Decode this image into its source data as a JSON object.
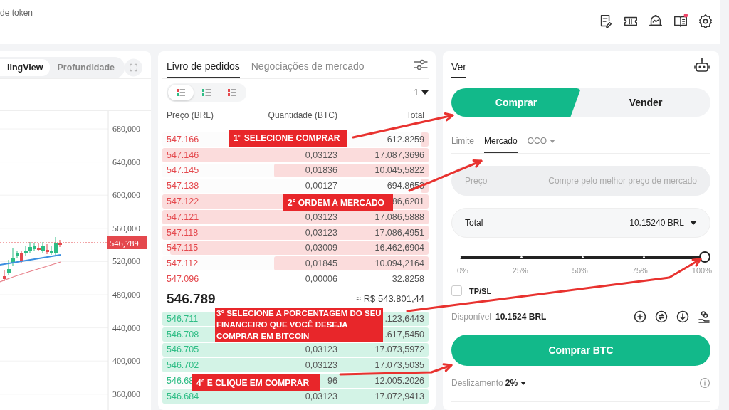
{
  "top_bar": {
    "title": "de token",
    "icons": [
      {
        "kind": "notes",
        "badge": false
      },
      {
        "kind": "ticket",
        "badge": false
      },
      {
        "kind": "bell",
        "badge": false
      },
      {
        "kind": "book",
        "badge": true
      },
      {
        "kind": "settings",
        "badge": false
      }
    ]
  },
  "chart": {
    "tabs": [
      {
        "label": "lingView",
        "selected": true
      },
      {
        "label": "Profundidade",
        "selected": false
      }
    ],
    "y_labels": [
      "680,000",
      "640,000",
      "600,000",
      "560,000",
      "520,000",
      "480,000",
      "440,000",
      "400,000",
      "360,000"
    ],
    "price_tag": "546,789"
  },
  "order_book": {
    "tabs": [
      {
        "label": "Livro de pedidos",
        "selected": true
      },
      {
        "label": "Negociações de mercado",
        "selected": false
      }
    ],
    "views": [
      {
        "kind": "both",
        "selected": true
      },
      {
        "kind": "bids",
        "selected": false
      },
      {
        "kind": "asks",
        "selected": false
      }
    ],
    "precision": "1",
    "columns": [
      "Preço (BRL)",
      "Quantidade (BTC)",
      "Total"
    ],
    "asks": [
      {
        "price": "547.166",
        "total": "612.8259",
        "level": 0.03
      },
      {
        "price": "547.146",
        "quantity": "0,03123",
        "total": "17.087,3696",
        "level": 1
      },
      {
        "price": "547.145",
        "quantity": "0,01836",
        "total": "10.045,5822",
        "level": 0.58
      },
      {
        "price": "547.138",
        "quantity": "0,00127",
        "total": "694.8653",
        "level": 0.03
      },
      {
        "price": "547.122",
        "total": "86,6201",
        "level": 1
      },
      {
        "price": "547.121",
        "quantity": "0,03123",
        "total": "17.086,5888",
        "level": 1
      },
      {
        "price": "547.118",
        "quantity": "0,03123",
        "total": "17.086,4951",
        "level": 1
      },
      {
        "price": "547.115",
        "quantity": "0,03009",
        "total": "16.462,6904",
        "level": 0.97
      },
      {
        "price": "547.112",
        "quantity": "0,01845",
        "total": "10.094,2164",
        "level": 0.58
      },
      {
        "price": "547.096",
        "quantity": "0,00006",
        "total": "32.8258"
      }
    ],
    "last_price": "546.789",
    "last_price_fiat": "≈ R$ 543.801,44",
    "bids": [
      {
        "price": "546.711",
        "total": ".123,6443",
        "level": 1
      },
      {
        "price": "546.708",
        "total": ".617,5450",
        "level": 1
      },
      {
        "price": "546.705",
        "quantity": "0,03123",
        "total": "17.073,5972",
        "level": 1
      },
      {
        "price": "546.702",
        "quantity": "0,03123",
        "total": "17.073,5035",
        "level": 1
      },
      {
        "price": "546.68",
        "quantity": "96",
        "total": "12.005.2026",
        "level": 0.7
      },
      {
        "price": "546.684",
        "quantity": "0,03123",
        "total": "17.072,9413",
        "level": 1
      }
    ]
  },
  "trade": {
    "tab": "Ver",
    "sides": [
      {
        "label": "Comprar",
        "selected": true
      },
      {
        "label": "Vender",
        "selected": false
      }
    ],
    "order_types": [
      {
        "label": "Limite",
        "selected": false,
        "dropdown": false
      },
      {
        "label": "Mercado",
        "selected": true,
        "dropdown": false
      },
      {
        "label": "OCO",
        "selected": false,
        "dropdown": true
      }
    ],
    "price_field": {
      "label": "Preço",
      "placeholder": "Compre pelo melhor preço de mercado",
      "disabled": true
    },
    "total_field": {
      "label": "Total",
      "value": "10.15240 BRL"
    },
    "slider": {
      "level": 1,
      "marks": [
        "0%",
        "25%",
        "50%",
        "75%",
        "100%"
      ]
    },
    "tpsl": {
      "label": "TP/SL",
      "checked": false
    },
    "available_label": "Disponível",
    "available_value": "10.1524 BRL",
    "actions": [
      {
        "kind": "add"
      },
      {
        "kind": "transfer"
      },
      {
        "kind": "deposit"
      },
      {
        "kind": "earn"
      }
    ],
    "submit": "Comprar BTC",
    "slippage_label": "Deslizamento",
    "slippage_value": "2%"
  },
  "annotations": [
    {
      "text": "1° SELECIONE COMPRAR",
      "kind": "step1"
    },
    {
      "text": "2° ORDEM A MERCADO",
      "kind": "step2"
    },
    {
      "text": "3° SELECIONE A PORCENTAGEM DO SEU FINANCEIRO QUE VOCÊ DESEJA COMPRAR EM BITCOIN",
      "kind": "step3"
    },
    {
      "text": "4° E CLIQUE EM COMPRAR",
      "kind": "step4"
    }
  ]
}
